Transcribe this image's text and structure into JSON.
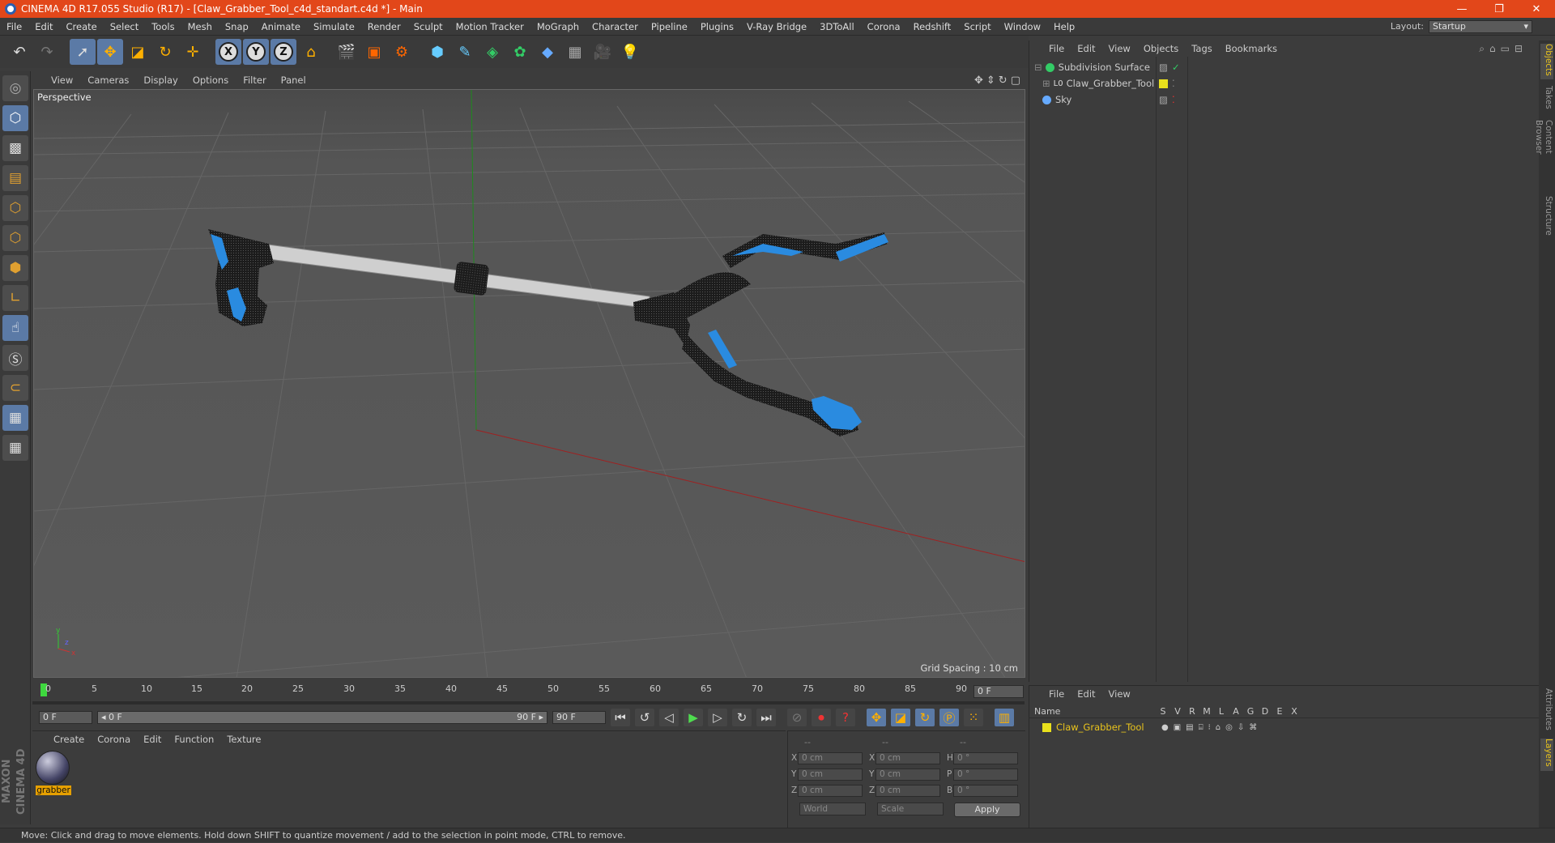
{
  "title": "CINEMA 4D R17.055 Studio (R17) - [Claw_Grabber_Tool_c4d_standart.c4d *] - Main",
  "window_controls": [
    "—",
    "❐",
    "✕"
  ],
  "menu": [
    "File",
    "Edit",
    "Create",
    "Select",
    "Tools",
    "Mesh",
    "Snap",
    "Animate",
    "Simulate",
    "Render",
    "Sculpt",
    "Motion Tracker",
    "MoGraph",
    "Character",
    "Pipeline",
    "Plugins",
    "V-Ray Bridge",
    "3DToAll",
    "Corona",
    "Redshift",
    "Script",
    "Window",
    "Help"
  ],
  "layout": {
    "label": "Layout:",
    "value": "Startup"
  },
  "viewport": {
    "menu": [
      "View",
      "Cameras",
      "Display",
      "Options",
      "Filter",
      "Panel"
    ],
    "label": "Perspective",
    "grid_spacing": "Grid Spacing : 10 cm"
  },
  "timeline": {
    "ticks": [
      "0",
      "5",
      "10",
      "15",
      "20",
      "25",
      "30",
      "35",
      "40",
      "45",
      "50",
      "55",
      "60",
      "65",
      "70",
      "75",
      "80",
      "85",
      "90"
    ],
    "current_frame": "0 F",
    "start": "0 F",
    "slider_left": "◂ 0 F",
    "slider_right": "90 F ▸",
    "end": "90 F"
  },
  "material_panel": {
    "menu": [
      "Create",
      "Corona",
      "Edit",
      "Function",
      "Texture"
    ],
    "material_name": "grabber"
  },
  "coords": {
    "headers": [
      "--",
      "--",
      "--"
    ],
    "rows": [
      {
        "a": "X",
        "av": "0 cm",
        "b": "X",
        "bv": "0 cm",
        "c": "H",
        "cv": "0 °"
      },
      {
        "a": "Y",
        "av": "0 cm",
        "b": "Y",
        "bv": "0 cm",
        "c": "P",
        "cv": "0 °"
      },
      {
        "a": "Z",
        "av": "0 cm",
        "b": "Z",
        "bv": "0 cm",
        "c": "B",
        "cv": "0 °"
      }
    ],
    "mode": "World",
    "size_mode": "Scale",
    "apply": "Apply"
  },
  "objects_panel": {
    "menu": [
      "File",
      "Edit",
      "View",
      "Objects",
      "Tags",
      "Bookmarks"
    ],
    "items": [
      {
        "name": "Subdivision Surface"
      },
      {
        "name": "Claw_Grabber_Tool"
      },
      {
        "name": "Sky"
      }
    ]
  },
  "layers_panel": {
    "menu": [
      "File",
      "Edit",
      "View"
    ],
    "columns": [
      "Name",
      "S",
      "V",
      "R",
      "M",
      "L",
      "A",
      "G",
      "D",
      "E",
      "X"
    ],
    "items": [
      {
        "name": "Claw_Grabber_Tool"
      }
    ]
  },
  "side_tabs": [
    "Objects",
    "Takes",
    "Content Browser",
    "Structure"
  ],
  "side_tabs_bottom": [
    "Attributes",
    "Layers"
  ],
  "maxon": "MAXON CINEMA 4D",
  "status": "Move: Click and drag to move elements. Hold down SHIFT to quantize movement / add to the selection in point mode, CTRL to remove."
}
